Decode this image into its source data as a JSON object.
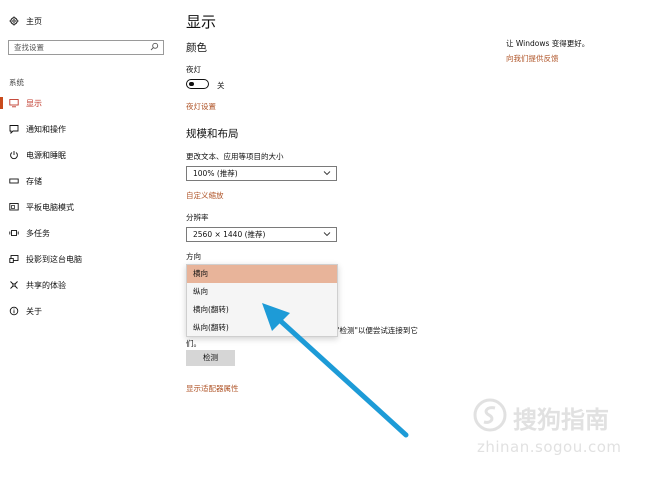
{
  "sidebar": {
    "home_label": "主页",
    "search_placeholder": "查找设置",
    "section_label": "系统",
    "items": [
      {
        "label": "显示",
        "active": true
      },
      {
        "label": "通知和操作"
      },
      {
        "label": "电源和睡眠"
      },
      {
        "label": "存储"
      },
      {
        "label": "平板电脑模式"
      },
      {
        "label": "多任务"
      },
      {
        "label": "投影到这台电脑"
      },
      {
        "label": "共享的体验"
      },
      {
        "label": "关于"
      }
    ]
  },
  "main": {
    "title": "显示",
    "color_heading": "颜色",
    "night_light_label": "夜灯",
    "night_light_state": "关",
    "night_light_settings_link": "夜灯设置",
    "scale_heading": "规模和布局",
    "scale_label": "更改文本、应用等项目的大小",
    "scale_value": "100% (推荐)",
    "custom_scale_link": "自定义缩放",
    "resolution_label": "分辨率",
    "resolution_value": "2560 × 1440 (推荐)",
    "orientation_label": "方向",
    "orientation_options": [
      "横向",
      "纵向",
      "横向(翻转)",
      "纵向(翻转)"
    ],
    "orientation_selected": "横向",
    "partial_text_line1": "\"检测\"以便尝试连接到它",
    "partial_text_line2": "们。",
    "detect_button": "检测",
    "adapter_link": "显示适配器属性"
  },
  "right_panel": {
    "text": "让 Windows 变得更好。",
    "link": "向我们提供反馈"
  },
  "watermark": {
    "brand": "搜狗指南",
    "url": "zhinan.sogou.com"
  },
  "colors": {
    "accent": "#c84a1b",
    "link": "#b0562a",
    "selected_option": "#e8b49a",
    "arrow": "#1d9bd7"
  }
}
